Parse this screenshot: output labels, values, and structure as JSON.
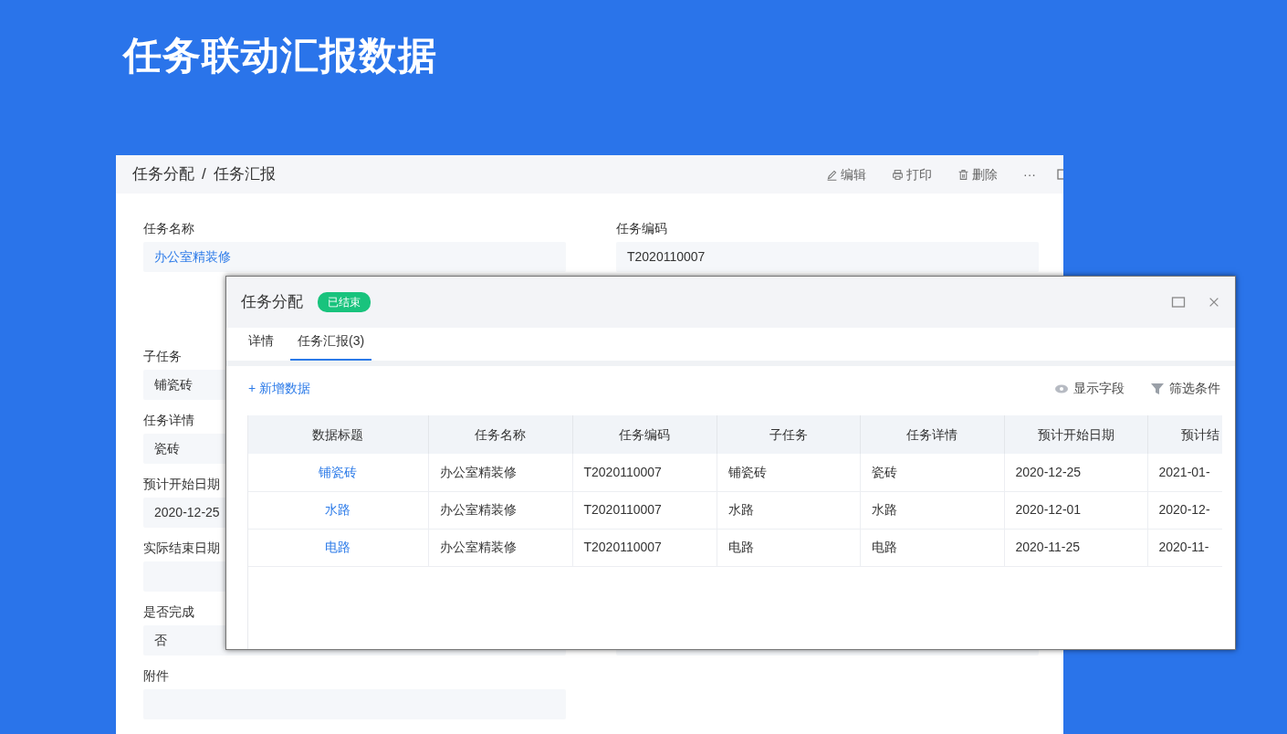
{
  "headline": "任务联动汇报数据",
  "back_window": {
    "breadcrumb": [
      "任务分配",
      "任务汇报"
    ],
    "separator": "/",
    "actions": [
      {
        "kind": "edit",
        "label": "编辑"
      },
      {
        "kind": "print",
        "label": "打印"
      },
      {
        "kind": "delete",
        "label": "删除"
      },
      {
        "kind": "more",
        "label": "···"
      },
      {
        "kind": "window"
      }
    ],
    "rows": [
      {
        "left": {
          "label": "任务名称",
          "value": "办公室精装修",
          "link": true
        },
        "right": {
          "label": "任务编码",
          "value": "T2020110007",
          "link": false
        }
      },
      {
        "kind": "blank"
      },
      {
        "left": {
          "label": "子任务",
          "value": "铺瓷砖",
          "link": false
        }
      },
      {
        "left": {
          "label": "任务详情",
          "value": "瓷砖",
          "link": false
        }
      },
      {
        "left": {
          "label": "预计开始日期",
          "value": "2020-12-25",
          "link": false
        }
      },
      {
        "left": {
          "label": "实际结束日期",
          "kind": "field"
        }
      },
      {
        "left": {
          "label": "是否完成",
          "value": "否",
          "link": false
        },
        "right": {
          "kind": "field"
        }
      },
      {
        "left": {
          "label": "附件",
          "kind": "field"
        }
      }
    ]
  },
  "dialog": {
    "title": "任务分配",
    "status": "已结束",
    "tabs": [
      {
        "label": "详情",
        "selected": false
      },
      {
        "label": "任务汇报(3)",
        "selected": true
      }
    ],
    "add_button": "+ 新增数据",
    "tools": [
      {
        "kind": "eye",
        "label": "显示字段"
      },
      {
        "kind": "filter",
        "label": "筛选条件"
      }
    ],
    "table": {
      "columns": [
        "数据标题",
        "任务名称",
        "任务编码",
        "子任务",
        "任务详情",
        "预计开始日期",
        "预计结"
      ],
      "rows": [
        [
          "铺瓷砖",
          "办公室精装修",
          "T2020110007",
          "铺瓷砖",
          "瓷砖",
          "2020-12-25",
          "2021-01-"
        ],
        [
          "水路",
          "办公室精装修",
          "T2020110007",
          "水路",
          "水路",
          "2020-12-01",
          "2020-12-"
        ],
        [
          "电路",
          "办公室精装修",
          "T2020110007",
          "电路",
          "电路",
          "2020-11-25",
          "2020-11-"
        ]
      ]
    }
  }
}
